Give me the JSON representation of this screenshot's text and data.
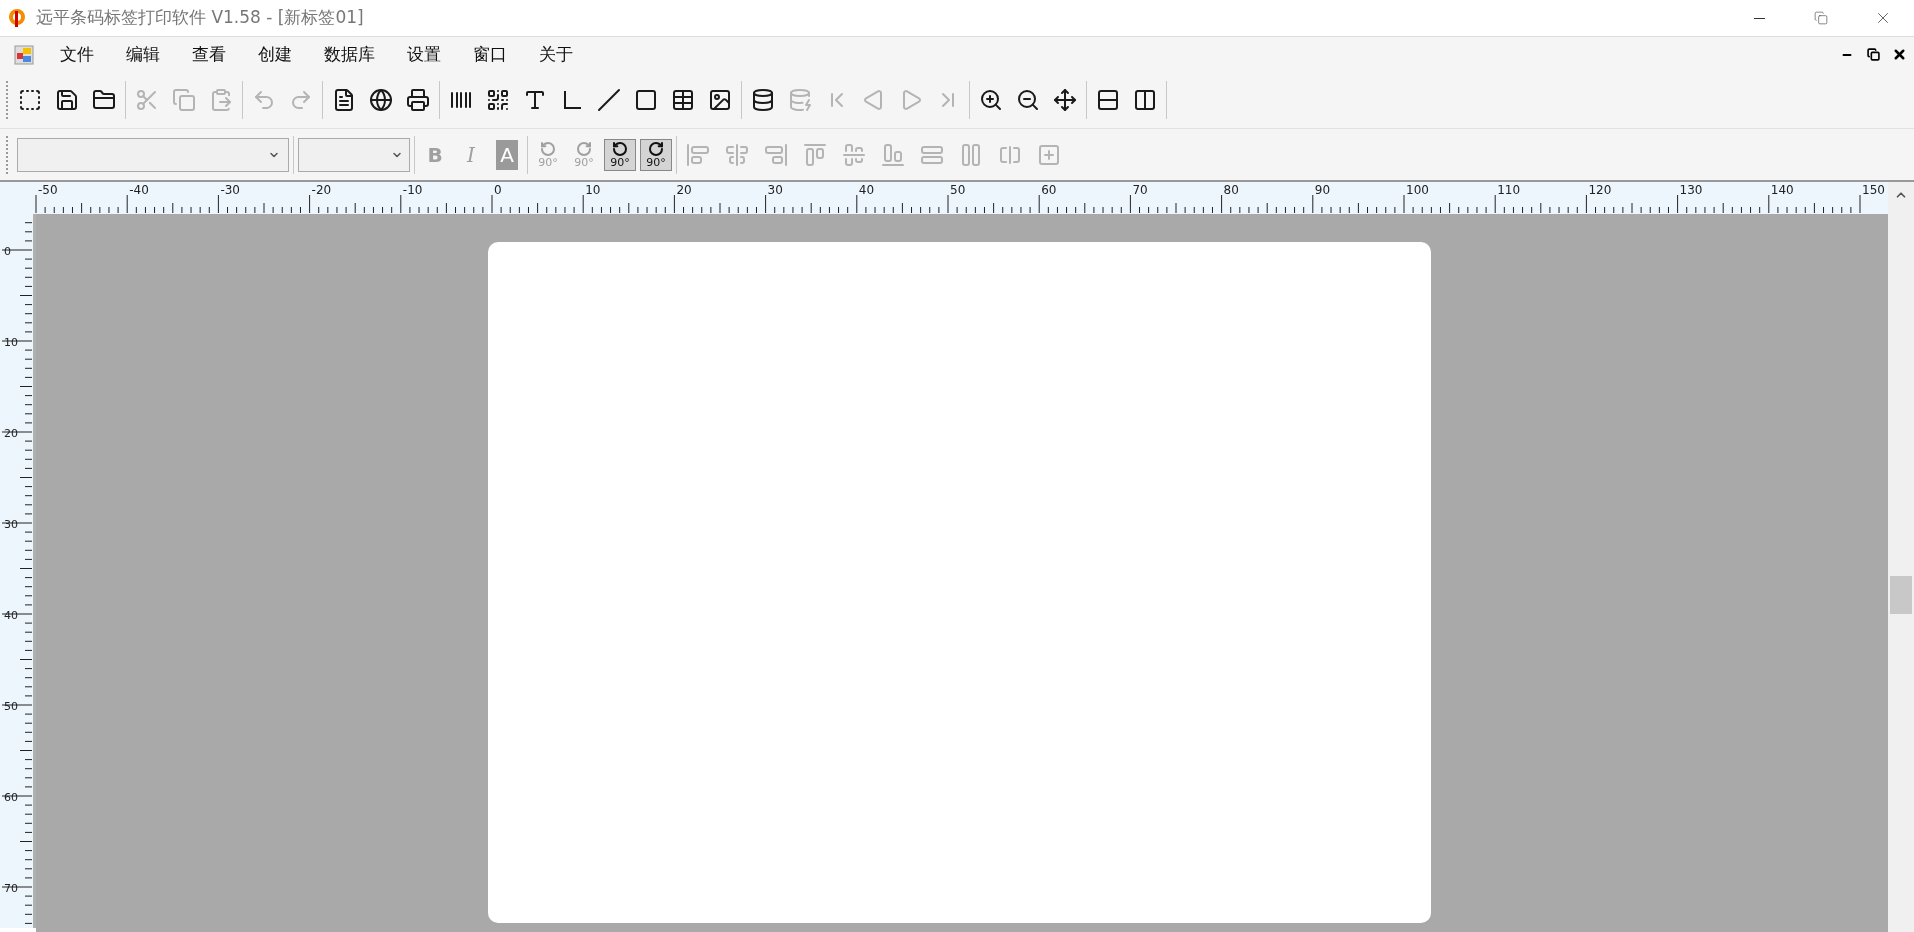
{
  "window": {
    "title": "远平条码标签打印软件 V1.58 - [新标签01]"
  },
  "menu": [
    "文件",
    "编辑",
    "查看",
    "创建",
    "数据库",
    "设置",
    "窗口",
    "关于"
  ],
  "toolbar": [
    [
      {
        "kind": "new",
        "disabled": false
      },
      {
        "kind": "save",
        "disabled": false
      },
      {
        "kind": "open",
        "disabled": false
      }
    ],
    [
      {
        "kind": "cut",
        "disabled": true
      },
      {
        "kind": "copy",
        "disabled": true
      },
      {
        "kind": "paste",
        "disabled": true
      }
    ],
    [
      {
        "kind": "undo",
        "disabled": true
      },
      {
        "kind": "redo",
        "disabled": true
      }
    ],
    [
      {
        "kind": "page",
        "disabled": false
      },
      {
        "kind": "web",
        "disabled": false
      },
      {
        "kind": "print",
        "disabled": false
      }
    ],
    [
      {
        "kind": "barcode",
        "disabled": false
      },
      {
        "kind": "qrcode",
        "disabled": false
      },
      {
        "kind": "text",
        "disabled": false
      },
      {
        "kind": "corner",
        "disabled": false
      },
      {
        "kind": "line",
        "disabled": false
      },
      {
        "kind": "rect",
        "disabled": false
      },
      {
        "kind": "table",
        "disabled": false
      },
      {
        "kind": "image",
        "disabled": false
      }
    ],
    [
      {
        "kind": "database",
        "disabled": false
      },
      {
        "kind": "database-settings",
        "disabled": true
      },
      {
        "kind": "first",
        "disabled": true
      },
      {
        "kind": "prev",
        "disabled": true
      },
      {
        "kind": "next",
        "disabled": true
      },
      {
        "kind": "last",
        "disabled": true
      }
    ],
    [
      {
        "kind": "zoom-in",
        "disabled": false
      },
      {
        "kind": "zoom-out",
        "disabled": false
      },
      {
        "kind": "fit",
        "disabled": false
      }
    ],
    [
      {
        "kind": "rows",
        "disabled": false
      },
      {
        "kind": "columns",
        "disabled": false
      }
    ]
  ],
  "format_bar": {
    "style": [
      {
        "kind": "bold",
        "label": "B",
        "disabled": true
      },
      {
        "kind": "italic",
        "label": "I",
        "disabled": true
      },
      {
        "kind": "color",
        "label": "A",
        "disabled": true
      }
    ],
    "rotate": [
      {
        "kind": "ccw",
        "label": "90°",
        "disabled": true
      },
      {
        "kind": "cw",
        "label": "90°",
        "disabled": true
      },
      {
        "kind": "ccw",
        "label": "90°",
        "disabled": false
      },
      {
        "kind": "cw",
        "label": "90°",
        "disabled": false
      }
    ],
    "align": [
      {
        "kind": "left",
        "disabled": true
      },
      {
        "kind": "center-h",
        "disabled": true
      },
      {
        "kind": "right",
        "disabled": true
      },
      {
        "kind": "top",
        "disabled": true
      },
      {
        "kind": "center-v",
        "disabled": true
      },
      {
        "kind": "bottom",
        "disabled": true
      },
      {
        "kind": "space-h",
        "disabled": true
      },
      {
        "kind": "space-v",
        "disabled": true
      },
      {
        "kind": "split-h",
        "disabled": true
      },
      {
        "kind": "split-v",
        "disabled": true
      }
    ]
  },
  "ruler": {
    "top_labels": [
      "-50",
      "-40",
      "-30",
      "-20",
      "-10",
      "0",
      "10",
      "20",
      "30",
      "40",
      "50",
      "60",
      "70",
      "80",
      "90",
      "100",
      "110",
      "120",
      "130",
      "140",
      "150"
    ],
    "left_labels": [
      "0",
      "10",
      "20",
      "30",
      "40",
      "50",
      "60",
      "70"
    ]
  }
}
